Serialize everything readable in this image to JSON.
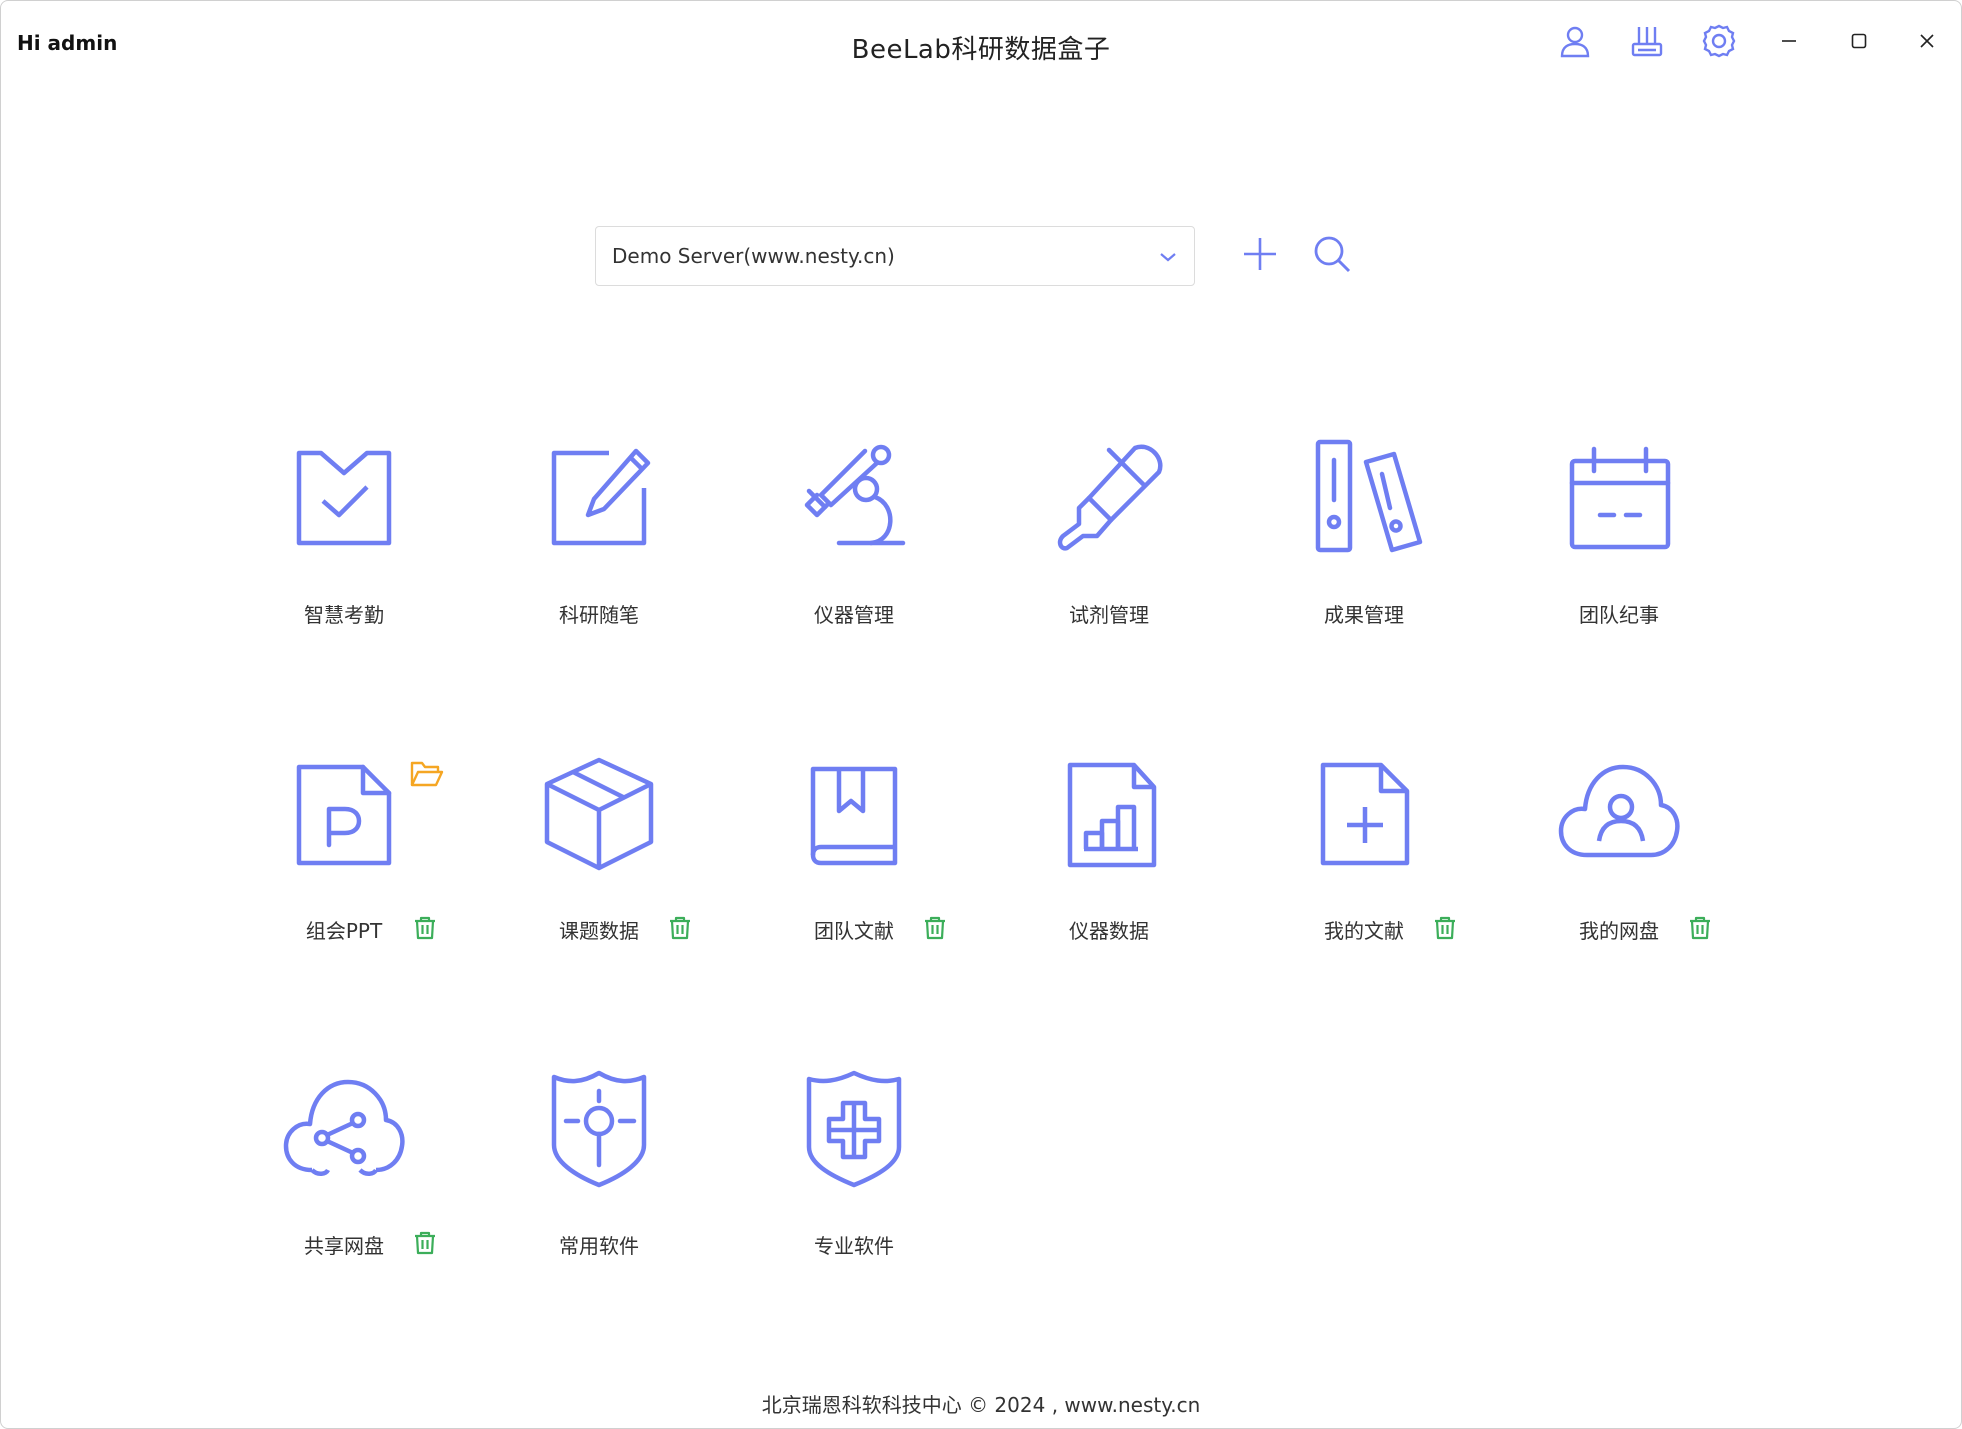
{
  "header": {
    "greeting": "Hi admin",
    "title": "BeeLab科研数据盒子"
  },
  "server": {
    "selected": "Demo Server(www.nesty.cn)"
  },
  "tiles": [
    {
      "label": "智慧考勤",
      "icon": "check-square-icon"
    },
    {
      "label": "科研随笔",
      "icon": "edit-icon"
    },
    {
      "label": "仪器管理",
      "icon": "microscope-icon"
    },
    {
      "label": "试剂管理",
      "icon": "thermometer-icon"
    },
    {
      "label": "成果管理",
      "icon": "binders-icon"
    },
    {
      "label": "团队纪事",
      "icon": "calendar-icon"
    },
    {
      "label": "组会PPT",
      "icon": "ppt-file-icon"
    },
    {
      "label": "课题数据",
      "icon": "box-icon"
    },
    {
      "label": "团队文献",
      "icon": "bookmark-book-icon"
    },
    {
      "label": "仪器数据",
      "icon": "bar-chart-file-icon"
    },
    {
      "label": "我的文献",
      "icon": "file-add-icon"
    },
    {
      "label": "我的网盘",
      "icon": "cloud-user-icon"
    },
    {
      "label": "共享网盘",
      "icon": "cloud-share-icon"
    },
    {
      "label": "常用软件",
      "icon": "shield-target-icon"
    },
    {
      "label": "专业软件",
      "icon": "shield-cross-icon"
    }
  ],
  "footer": {
    "text": "北京瑞恩科软科技中心 © 2024 , www.nesty.cn"
  },
  "colors": {
    "accent": "#6f7ef2",
    "trash": "#3cae5a",
    "folder": "#f5a623"
  }
}
